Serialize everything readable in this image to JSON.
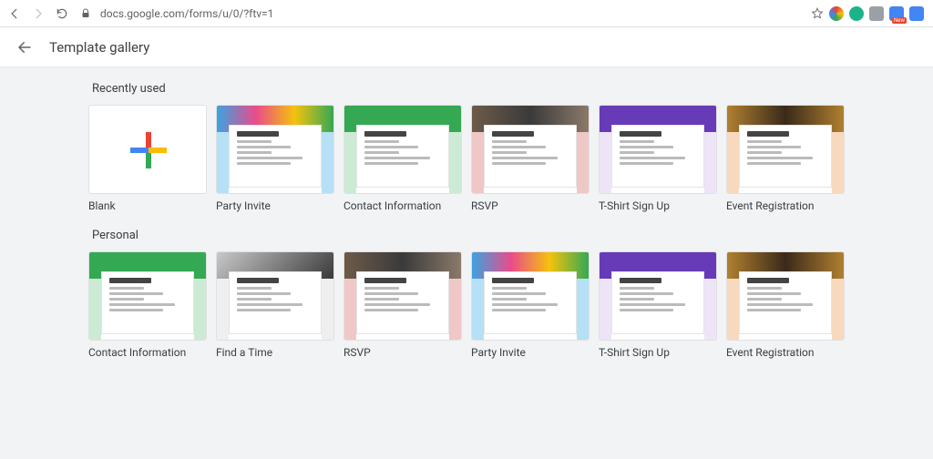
{
  "browser": {
    "url": "docs.google.com/forms/u/0/?ftv=1"
  },
  "header": {
    "title": "Template gallery"
  },
  "sections": [
    {
      "label": "Recently used",
      "cards": [
        {
          "label": "Blank",
          "kind": "blank"
        },
        {
          "label": "Party Invite",
          "kind": "party"
        },
        {
          "label": "Contact Information",
          "kind": "contact"
        },
        {
          "label": "RSVP",
          "kind": "rsvp"
        },
        {
          "label": "T-Shirt Sign Up",
          "kind": "tshirt"
        },
        {
          "label": "Event Registration",
          "kind": "event"
        }
      ]
    },
    {
      "label": "Personal",
      "cards": [
        {
          "label": "Contact Information",
          "kind": "contact"
        },
        {
          "label": "Find a Time",
          "kind": "findtime"
        },
        {
          "label": "RSVP",
          "kind": "rsvp"
        },
        {
          "label": "Party Invite",
          "kind": "party"
        },
        {
          "label": "T-Shirt Sign Up",
          "kind": "tshirt"
        },
        {
          "label": "Event Registration",
          "kind": "event"
        }
      ]
    }
  ],
  "theme": {
    "party": {
      "band": "linear-gradient(90deg,#3ba3e0,#e94b8b,#f4c20d,#34a853)",
      "side": "#b6e0f6"
    },
    "contact": {
      "band": "#34a853",
      "side": "#cdebd4"
    },
    "rsvp": {
      "band": "linear-gradient(90deg,#6d5b4a,#3a3a3a,#8a7a6a)",
      "side": "#f0c7c7"
    },
    "tshirt": {
      "band": "#673ab7",
      "side": "#ede4f7"
    },
    "event": {
      "band": "linear-gradient(90deg,#b08030,#3a2a1a,#b08030)",
      "side": "#f7d9be"
    },
    "findtime": {
      "band": "linear-gradient(135deg,#c9c9c9,#3a3a3a)",
      "side": "#efefef"
    }
  }
}
